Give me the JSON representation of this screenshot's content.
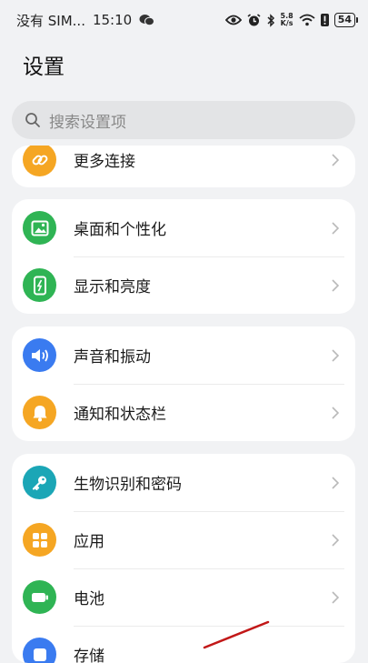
{
  "status_bar": {
    "carrier": "没有 SIM...",
    "time": "15:10",
    "speed_value": "5.8",
    "speed_unit": "K/s",
    "battery": "54"
  },
  "page": {
    "title": "设置"
  },
  "search": {
    "placeholder": "搜索设置项"
  },
  "groups": [
    {
      "items": [
        {
          "label": "更多连接",
          "icon": "link-icon",
          "color": "#f5a623"
        }
      ]
    },
    {
      "items": [
        {
          "label": "桌面和个性化",
          "icon": "image-icon",
          "color": "#2fb454"
        },
        {
          "label": "显示和亮度",
          "icon": "phone-brightness-icon",
          "color": "#2fb454"
        }
      ]
    },
    {
      "items": [
        {
          "label": "声音和振动",
          "icon": "speaker-icon",
          "color": "#3a7bf0"
        },
        {
          "label": "通知和状态栏",
          "icon": "bell-icon",
          "color": "#f5a623"
        }
      ]
    },
    {
      "items": [
        {
          "label": "生物识别和密码",
          "icon": "key-icon",
          "color": "#1ba6b6"
        },
        {
          "label": "应用",
          "icon": "apps-grid-icon",
          "color": "#f5a623"
        },
        {
          "label": "电池",
          "icon": "battery-icon",
          "color": "#2fb454"
        },
        {
          "label": "存储",
          "icon": "storage-icon",
          "color": "#3a7bf0"
        }
      ]
    }
  ]
}
